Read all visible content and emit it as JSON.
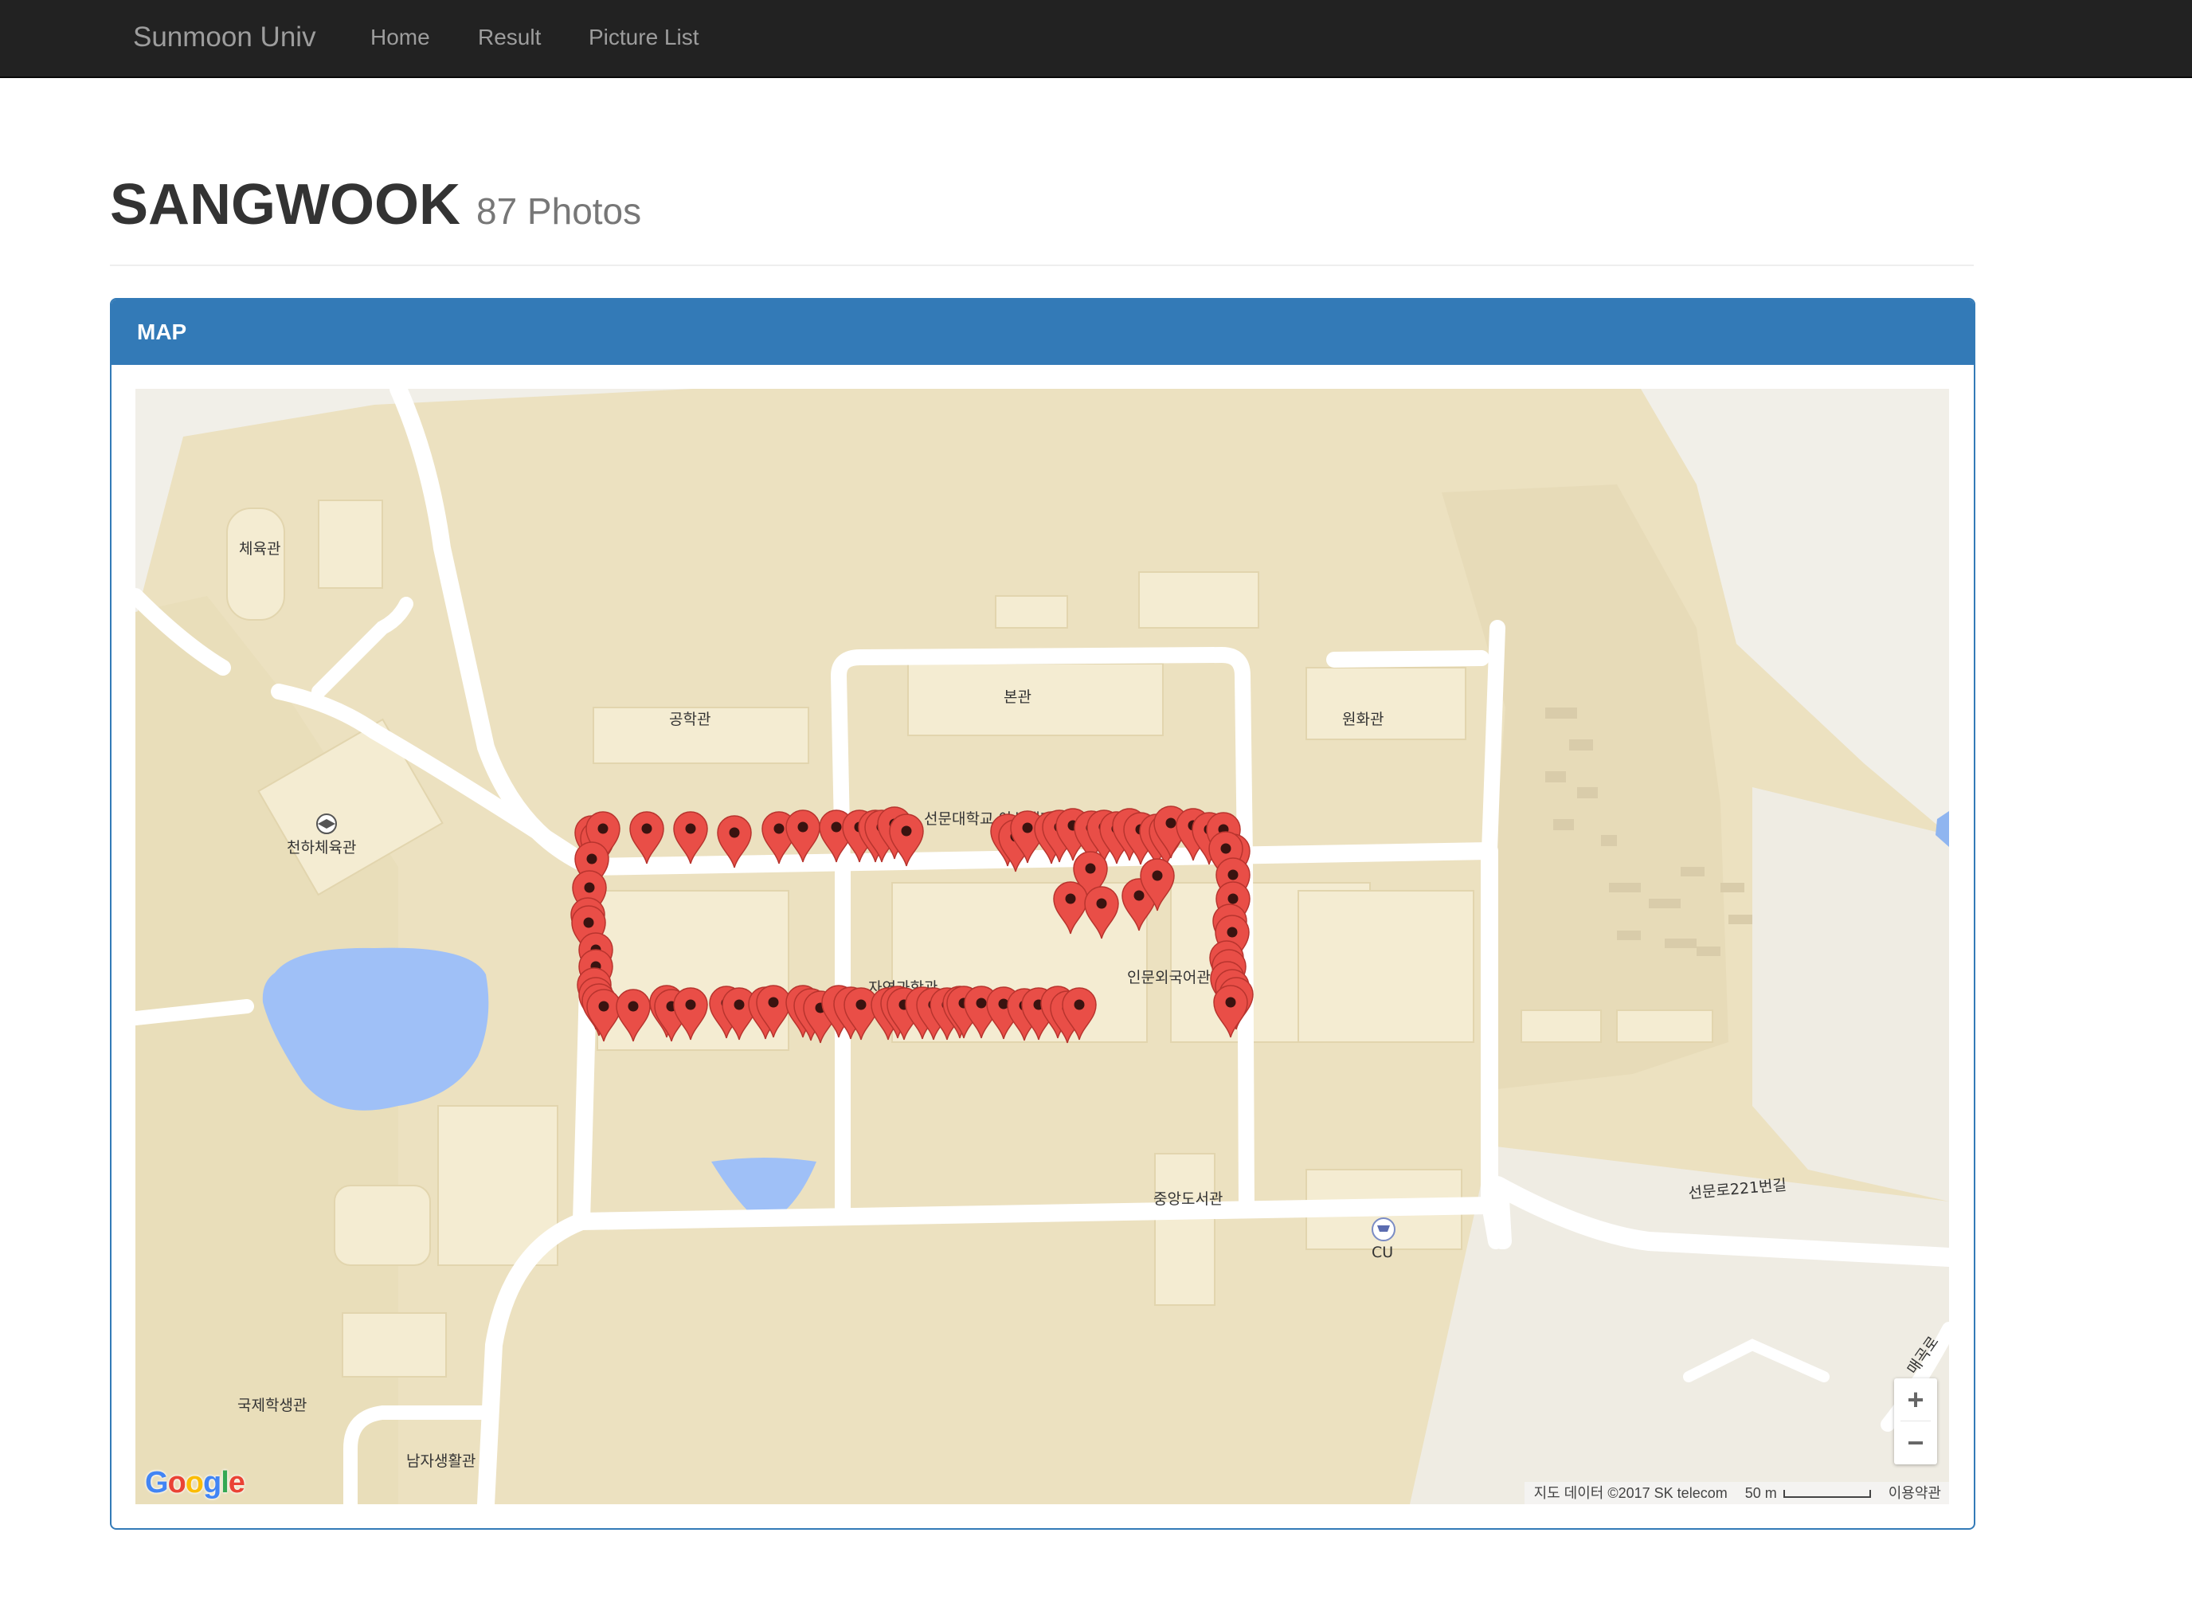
{
  "navbar": {
    "brand": "Sunmoon Univ",
    "items": [
      {
        "label": "Home"
      },
      {
        "label": "Result"
      },
      {
        "label": "Picture List"
      }
    ]
  },
  "header": {
    "title": "SANGWOOK",
    "photo_count": "87 Photos"
  },
  "panel": {
    "title": "MAP"
  },
  "map": {
    "marker_count": 87,
    "marker_color": "#e94e47",
    "labels": [
      {
        "text": "체육관"
      },
      {
        "text": "천하체육관"
      },
      {
        "text": "공학관"
      },
      {
        "text": "본관"
      },
      {
        "text": "원화관"
      },
      {
        "text": "자연과학관"
      },
      {
        "text": "인문외국어관"
      },
      {
        "text": "중앙도서관"
      },
      {
        "text": "CU"
      },
      {
        "text": "국제학생관"
      },
      {
        "text": "남자생활관"
      },
      {
        "text": "선문로221번길"
      },
      {
        "text": "매곡로"
      }
    ],
    "partial_label": "선문대학교 아산캠퍼스",
    "zoom_in": "+",
    "zoom_out": "−",
    "logo": [
      "G",
      "o",
      "o",
      "g",
      "l",
      "e"
    ],
    "logo_colors": [
      "#4285f4",
      "#ea4335",
      "#fbbc05",
      "#4285f4",
      "#34a853",
      "#ea4335"
    ],
    "attribution": {
      "data": "지도 데이터 ©2017 SK telecom",
      "scale": "50 m",
      "terms": "이용약관"
    }
  }
}
